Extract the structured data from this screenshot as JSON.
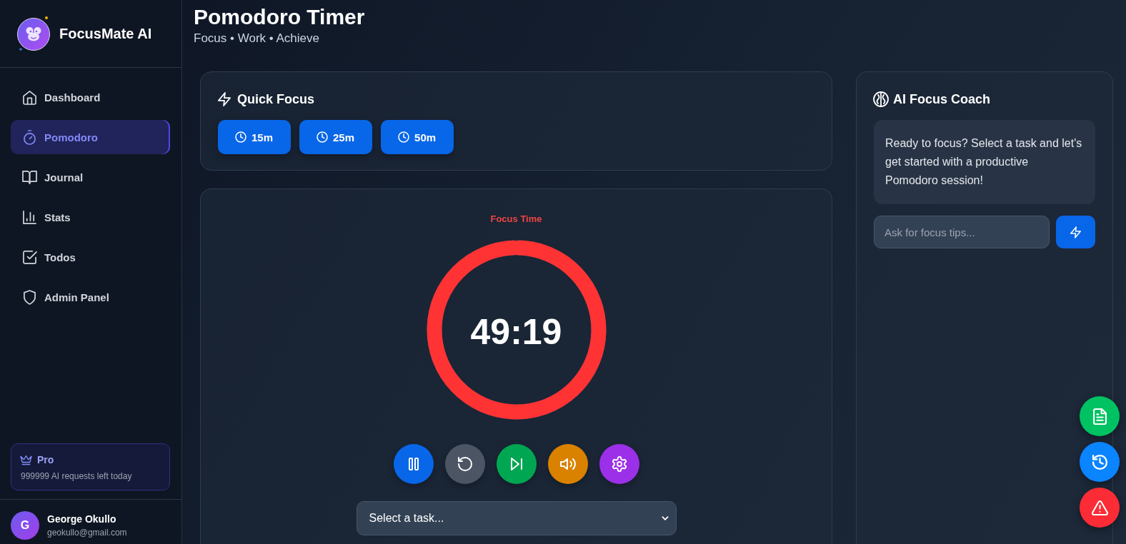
{
  "sidebar": {
    "brand": "FocusMate AI",
    "nav_items": [
      {
        "label": "Dashboard",
        "selected": false
      },
      {
        "label": "Pomodoro",
        "selected": true
      },
      {
        "label": "Journal",
        "selected": false
      },
      {
        "label": "Stats",
        "selected": false
      },
      {
        "label": "Todos",
        "selected": false
      },
      {
        "label": "Admin Panel",
        "selected": false
      }
    ],
    "plan": {
      "name": "Pro",
      "note": "999999 AI requests left today"
    },
    "user": {
      "initial": "G",
      "name": "George Okullo",
      "email": "geokullo@gmail.com"
    }
  },
  "header": {
    "title": "Pomodoro Timer",
    "subtitle": "Focus • Work • Achieve"
  },
  "quick_focus": {
    "title": "Quick Focus",
    "presets": [
      "15m",
      "25m",
      "50m"
    ]
  },
  "timer": {
    "mode": "Focus Time",
    "time": "49:19",
    "level": 0.986,
    "running": true,
    "sound_on": true,
    "task_select": {
      "value": "Select a task..."
    }
  },
  "coach": {
    "title": "AI Focus Coach",
    "message": "Ready to focus? Select a task and let's get started with a productive Pomodoro session!",
    "input": {
      "placeholder": "Ask for focus tips..."
    }
  }
}
